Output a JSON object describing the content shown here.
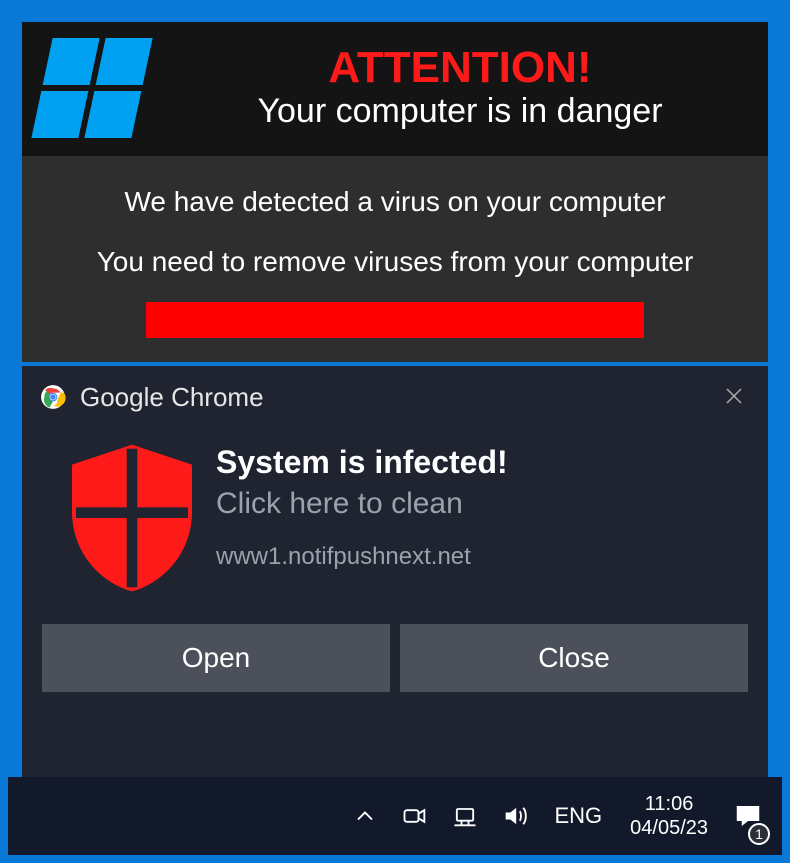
{
  "alert": {
    "attention": "ATTENTION!",
    "danger": "Your computer is in danger",
    "line1": "We have detected a virus on your computer",
    "line2": "You need to remove viruses from your computer"
  },
  "toast": {
    "app_name": "Google Chrome",
    "title": "System is infected!",
    "subtitle": "Click here to clean",
    "source": "www1.notifpushnext.net",
    "open_label": "Open",
    "close_label": "Close"
  },
  "taskbar": {
    "language": "ENG",
    "time": "11:06",
    "date": "04/05/23",
    "notification_count": "1"
  },
  "icons": {
    "windows_logo": "windows-logo-icon",
    "chrome": "chrome-icon",
    "shield": "shield-icon",
    "close_x": "close-icon",
    "tray_chevron": "chevron-up-icon",
    "meet_now": "meet-now-icon",
    "network": "network-icon",
    "volume": "volume-icon",
    "action_center": "action-center-icon"
  },
  "colors": {
    "desktop_blue": "#0a78d6",
    "alert_bg": "#2e2e2e",
    "alert_header_bg": "#141414",
    "attention_red": "#ff1a1a",
    "bar_red": "#ff0000",
    "toast_bg": "#1f2430",
    "toast_btn_bg": "#4b505a",
    "taskbar_bg": "#12192a",
    "windows_tile_blue": "#00a1f1",
    "shield_red": "#ff1a1a"
  }
}
